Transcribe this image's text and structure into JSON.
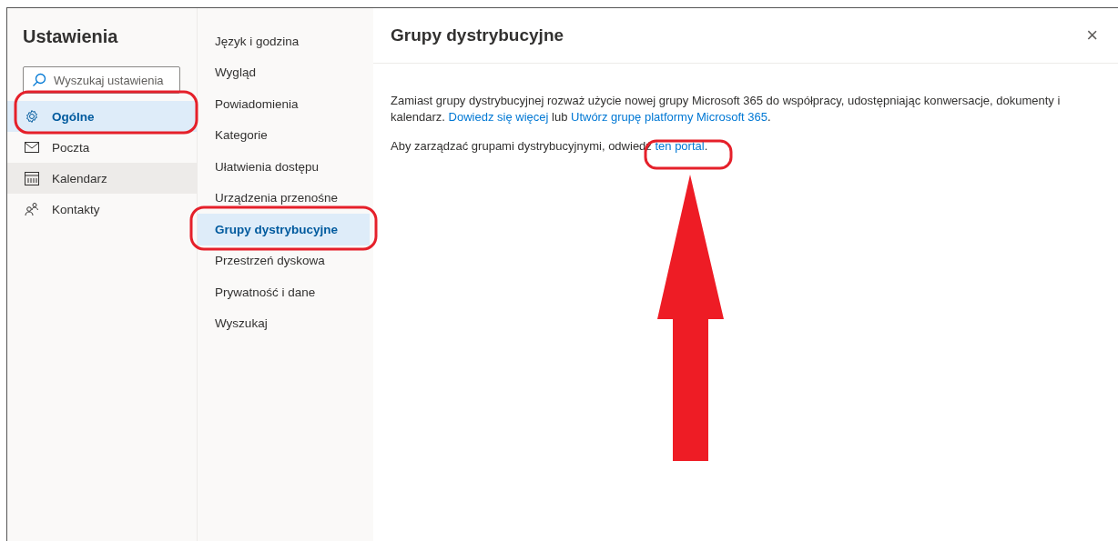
{
  "sidebar": {
    "title": "Ustawienia",
    "search": {
      "placeholder": "Wyszukaj ustawienia"
    },
    "items": [
      {
        "label": "Ogólne",
        "kind": "gear",
        "selected": true,
        "hovered": false
      },
      {
        "label": "Poczta",
        "kind": "mail",
        "selected": false,
        "hovered": false
      },
      {
        "label": "Kalendarz",
        "kind": "calendar",
        "selected": false,
        "hovered": true
      },
      {
        "label": "Kontakty",
        "kind": "people",
        "selected": false,
        "hovered": false
      }
    ]
  },
  "subnav": {
    "items": [
      {
        "label": "Język i godzina",
        "selected": false
      },
      {
        "label": "Wygląd",
        "selected": false
      },
      {
        "label": "Powiadomienia",
        "selected": false
      },
      {
        "label": "Kategorie",
        "selected": false
      },
      {
        "label": "Ułatwienia dostępu",
        "selected": false
      },
      {
        "label": "Urządzenia przenośne",
        "selected": false
      },
      {
        "label": "Grupy dystrybucyjne",
        "selected": true
      },
      {
        "label": "Przestrzeń dyskowa",
        "selected": false
      },
      {
        "label": "Prywatność i dane",
        "selected": false
      },
      {
        "label": "Wyszukaj",
        "selected": false
      }
    ]
  },
  "content": {
    "title": "Grupy dystrybucyjne",
    "close": "×",
    "paragraphs": [
      [
        {
          "kind": "text",
          "text": "Zamiast grupy dystrybucyjnej rozważ użycie nowej grupy Microsoft 365 do współpracy, udostępniając konwersacje, dokumenty i kalendarz. "
        },
        {
          "kind": "link",
          "text": "Dowiedz się więcej"
        },
        {
          "kind": "text",
          "text": " lub "
        },
        {
          "kind": "link",
          "text": "Utwórz grupę platformy Microsoft 365"
        },
        {
          "kind": "text",
          "text": "."
        }
      ],
      [
        {
          "kind": "text",
          "text": "Aby zarządzać grupami dystrybucyjnymi, odwiedź "
        },
        {
          "kind": "link",
          "text": "ten portal"
        },
        {
          "kind": "text",
          "text": "."
        }
      ]
    ]
  }
}
